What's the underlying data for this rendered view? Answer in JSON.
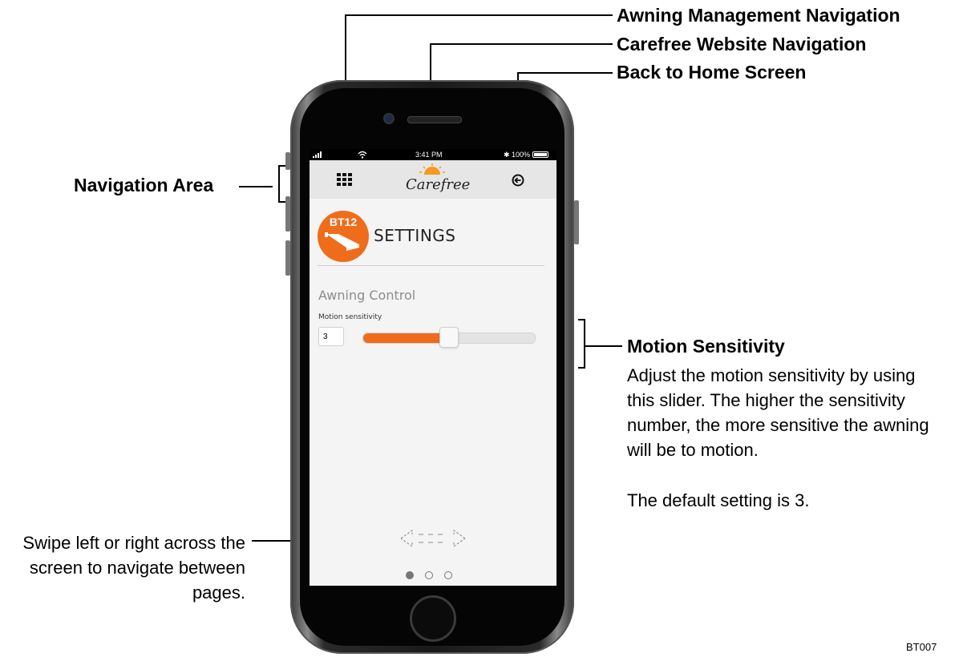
{
  "callouts": {
    "awning_management": "Awning Management Navigation",
    "carefree_website": "Carefree Website Navigation",
    "back_home": "Back to Home Screen",
    "navigation_area": "Navigation Area",
    "motion_title": "Motion Sensitivity",
    "motion_desc": "Adjust the motion sensitivity by using this slider.  The higher the sensitivity number, the more sensitive the awning will be to motion.",
    "motion_default": "The default setting is 3.",
    "swipe_hint": "Swipe left or right across the screen to navigate between pages.",
    "figure_code": "BT007"
  },
  "phone": {
    "status": {
      "time": "3:41 PM",
      "battery": "100%"
    },
    "nav": {
      "grid_icon": "grid-icon",
      "logo_text": "Carefree",
      "back_icon": "back-arrow-icon"
    },
    "badge_label": "BT12",
    "page_title": "SETTINGS",
    "section_title": "Awning Control",
    "slider": {
      "label": "Motion sensitivity",
      "value": "3",
      "fill_fraction": 0.5
    },
    "page_dots": {
      "count": 3,
      "active_index": 0
    }
  },
  "colors": {
    "accent": "#ef6c1a",
    "nav_bg": "#e6e6e6",
    "screen_bg": "#f4f4f4"
  }
}
